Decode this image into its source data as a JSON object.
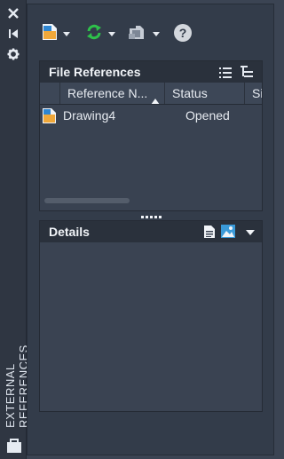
{
  "panel": {
    "vertical_title": "EXTERNAL REFERENCES"
  },
  "file_references": {
    "title": "File References",
    "columns": [
      "Reference N...",
      "Status",
      "Si"
    ],
    "rows": [
      {
        "name": "Drawing4",
        "status": "Opened"
      }
    ]
  },
  "details": {
    "title": "Details"
  },
  "icons": {
    "close": "close-icon",
    "collapse": "collapse-panel-icon",
    "settings": "gear-icon",
    "attach": "attach-dwg-icon",
    "refresh": "refresh-icon",
    "change_path": "change-path-icon",
    "help": "help-icon",
    "list_view": "list-view-icon",
    "tree_view": "tree-view-icon",
    "details_view": "details-view-icon",
    "preview": "preview-icon"
  },
  "colors": {
    "background": "#3b4453",
    "header": "#2a313c",
    "accent_blue": "#3a9ad9",
    "accent_green": "#2ec24a"
  }
}
